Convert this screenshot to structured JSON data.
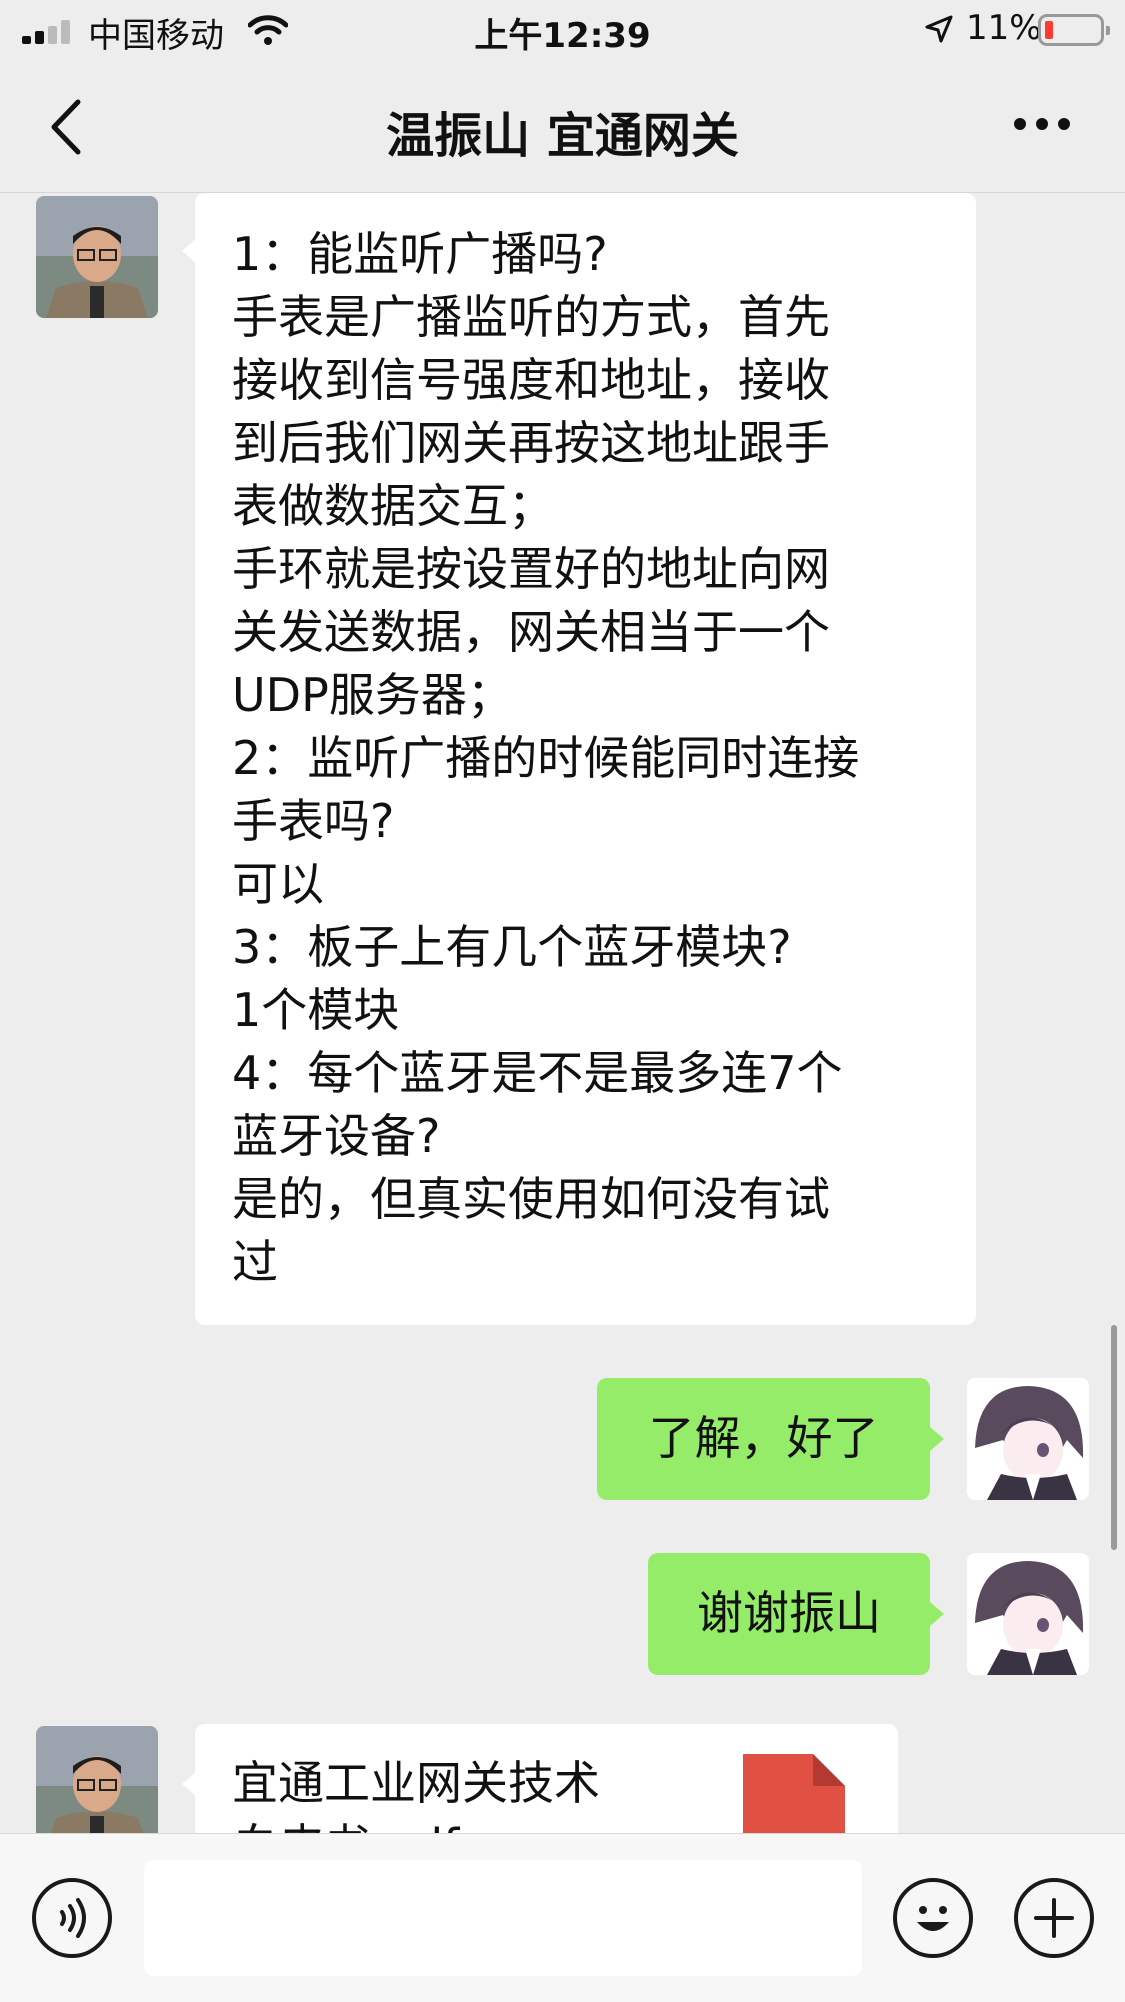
{
  "status_bar": {
    "carrier": "中国移动",
    "time": "上午12:39",
    "battery_percent": "11%"
  },
  "header": {
    "title": "温振山 宜通网关",
    "back_icon": "chevron-left-icon",
    "more_icon": "more-dots-icon"
  },
  "messages": [
    {
      "sender": "contact",
      "lines": [
        "1：能监听广播吗?",
        "手表是广播监听的方式，首先",
        "接收到信号强度和地址，接收",
        "到后我们网关再按这地址跟手",
        "表做数据交互；",
        "手环就是按设置好的地址向网",
        "关发送数据，网关相当于一个",
        "UDP服务器；",
        "2：监听广播的时候能同时连接",
        "手表吗?",
        "可以",
        "3：板子上有几个蓝牙模块?",
        "1个模块",
        "4：每个蓝牙是不是最多连7个",
        "蓝牙设备?",
        "是的，但真实使用如何没有试",
        "过"
      ]
    },
    {
      "sender": "self",
      "text": "了解，好了"
    },
    {
      "sender": "self",
      "text": "谢谢振山"
    },
    {
      "sender": "contact",
      "type": "file",
      "lines": [
        "宜通工业网关技术",
        "白皮书.pdf"
      ]
    }
  ],
  "input_bar": {
    "voice_icon": "voice-icon",
    "emoji_icon": "emoji-icon",
    "plus_icon": "plus-icon",
    "placeholder": ""
  },
  "colors": {
    "background": "#EDEDED",
    "self_bubble": "#95EC69",
    "contact_bubble": "#FFFFFF",
    "pdf_icon": "#E05144",
    "battery_low": "#FF3B30"
  }
}
